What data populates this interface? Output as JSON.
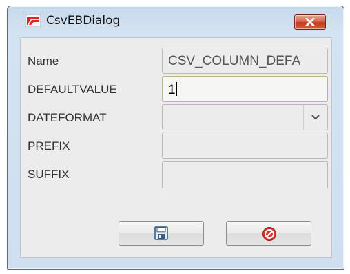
{
  "window": {
    "title": "CsvEBDialog",
    "app_icon": "app-logo-icon",
    "close_icon": "close-icon"
  },
  "form": {
    "name_label": "Name",
    "name_value": "CSV_COLUMN_DEFA",
    "defaultvalue_label": "DEFAULTVALUE",
    "defaultvalue_value": "1",
    "dateformat_label": "DATEFORMAT",
    "dateformat_value": "",
    "prefix_label": "PREFIX",
    "prefix_value": "",
    "suffix_label": "SUFFIX",
    "suffix_value": ""
  },
  "buttons": {
    "save_icon": "floppy-disk-icon",
    "cancel_icon": "cancel-icon"
  },
  "colors": {
    "close_button": "#c3391c",
    "cancel_icon": "#d9322b",
    "save_icon": "#3a5a86"
  }
}
